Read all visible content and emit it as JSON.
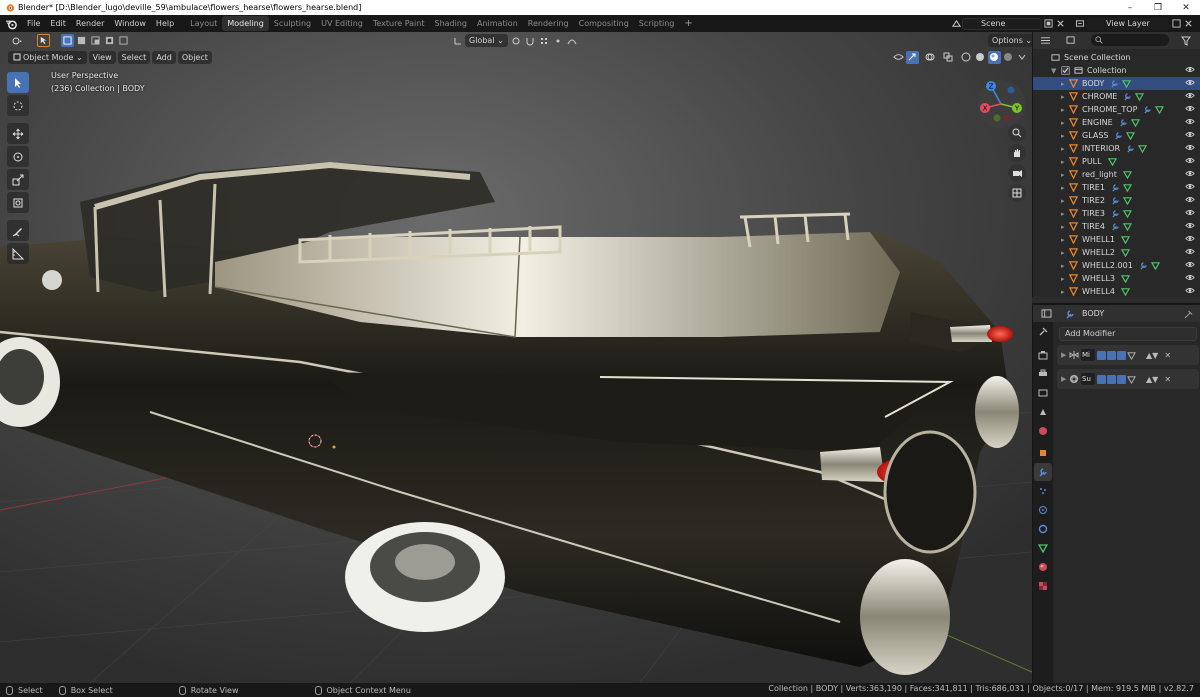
{
  "window": {
    "title": "Blender* [D:\\Blender_lugo\\deville_59\\ambulace\\flowers_hearse\\flowers_hearse.blend]",
    "minimize": "–",
    "maximize": "❐",
    "close": "✕"
  },
  "topbar": {
    "menus": [
      "File",
      "Edit",
      "Render",
      "Window",
      "Help"
    ],
    "workspaces": [
      "Layout",
      "Modeling",
      "Sculpting",
      "UV Editing",
      "Texture Paint",
      "Shading",
      "Animation",
      "Rendering",
      "Compositing",
      "Scripting"
    ],
    "active_workspace": "Modeling",
    "add_workspace": "+",
    "scene": "Scene",
    "view_layer": "View Layer"
  },
  "viewport": {
    "mode": "Object Mode",
    "menus": [
      "View",
      "Select",
      "Add",
      "Object"
    ],
    "transform_orientation": "Global",
    "options": "Options",
    "perspective_label": "User Perspective",
    "collection_label": "(236) Collection | BODY",
    "gizmo_axes": {
      "x": "X",
      "y": "Y",
      "z": "Z"
    }
  },
  "outliner": {
    "scene_collection": "Scene Collection",
    "collection": "Collection",
    "objects": [
      {
        "name": "BODY",
        "selected": true,
        "modifier": true
      },
      {
        "name": "CHROME",
        "selected": false,
        "modifier": true
      },
      {
        "name": "CHROME_TOP",
        "selected": false,
        "modifier": true
      },
      {
        "name": "ENGINE",
        "selected": false,
        "modifier": true
      },
      {
        "name": "GLASS",
        "selected": false,
        "modifier": true
      },
      {
        "name": "INTERIOR",
        "selected": false,
        "modifier": true
      },
      {
        "name": "PULL",
        "selected": false,
        "modifier": false
      },
      {
        "name": "red_light",
        "selected": false,
        "modifier": false
      },
      {
        "name": "TIRE1",
        "selected": false,
        "modifier": true
      },
      {
        "name": "TIRE2",
        "selected": false,
        "modifier": true
      },
      {
        "name": "TIRE3",
        "selected": false,
        "modifier": true
      },
      {
        "name": "TIRE4",
        "selected": false,
        "modifier": true
      },
      {
        "name": "WHELL1",
        "selected": false,
        "modifier": false
      },
      {
        "name": "WHELL2",
        "selected": false,
        "modifier": false
      },
      {
        "name": "WHELL2.001",
        "selected": false,
        "modifier": true
      },
      {
        "name": "WHELL3",
        "selected": false,
        "modifier": false
      },
      {
        "name": "WHELL4",
        "selected": false,
        "modifier": false
      }
    ]
  },
  "properties": {
    "object_name": "BODY",
    "add_modifier": "Add Modifier",
    "modifiers": [
      {
        "name": "Mi"
      },
      {
        "name": "Su"
      }
    ]
  },
  "statusbar": {
    "select": "Select",
    "box_select": "Box Select",
    "rotate_view": "Rotate View",
    "context_menu": "Object Context Menu",
    "stats": "Collection | BODY | Verts:363,190 | Faces:341,811 | Tris:686,031 | Objects:0/17 | Mem: 919.5 MiB | v2.82.7"
  },
  "colors": {
    "accent": "#4772b3",
    "selected_row": "#334d80",
    "mesh_icon": "#e8852e",
    "modifier_icon": "#5b8fd6",
    "data_icon": "#4fc46b",
    "axis_x": "#e24e5d",
    "axis_y": "#7fc12c",
    "axis_z": "#3e86e0"
  }
}
